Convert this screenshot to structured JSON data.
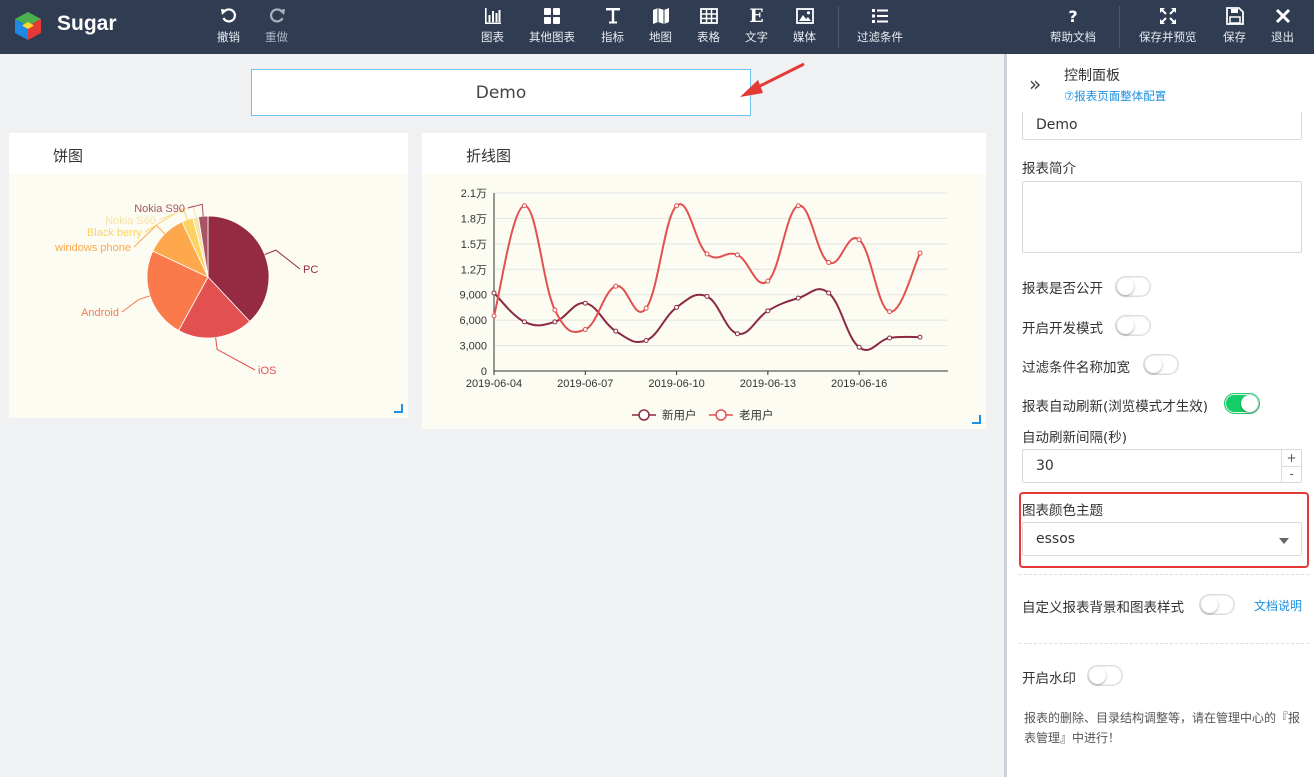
{
  "app": {
    "brand": "Sugar",
    "accent": "#2f3c52"
  },
  "toolbar": {
    "undo": "撤销",
    "redo": "重做",
    "chart": "图表",
    "other_charts": "其他图表",
    "metric": "指标",
    "map": "地图",
    "table": "表格",
    "text": "文字",
    "media": "媒体",
    "filter": "过滤条件",
    "help": "帮助文档",
    "save_preview": "保存并预览",
    "save": "保存",
    "exit": "退出"
  },
  "report": {
    "title": "Demo"
  },
  "pie_card": {
    "title": "饼图"
  },
  "line_card": {
    "title": "折线图"
  },
  "chart_data": [
    {
      "type": "pie",
      "title": "饼图",
      "slices": [
        {
          "label": "PC",
          "value": 38
        },
        {
          "label": "iOS",
          "value": 20
        },
        {
          "label": "Android",
          "value": 24
        },
        {
          "label": "windows phone",
          "value": 11
        },
        {
          "label": "Black berry",
          "value": 3
        },
        {
          "label": "Nokia S60",
          "value": 1.5
        },
        {
          "label": "Nokia S90",
          "value": 2.5
        }
      ],
      "colors": [
        "#952b43",
        "#e2504f",
        "#fb7a4b",
        "#fda84c",
        "#fdd35f",
        "#f7e3a8",
        "#a65466"
      ]
    },
    {
      "type": "line",
      "title": "折线图",
      "x": [
        "2019-06-04",
        "2019-06-05",
        "2019-06-06",
        "2019-06-07",
        "2019-06-08",
        "2019-06-09",
        "2019-06-10",
        "2019-06-11",
        "2019-06-12",
        "2019-06-13",
        "2019-06-14",
        "2019-06-15",
        "2019-06-16",
        "2019-06-17",
        "2019-06-18"
      ],
      "x_tick_labels": [
        "2019-06-04",
        "2019-06-07",
        "2019-06-10",
        "2019-06-13",
        "2019-06-16"
      ],
      "y_tick_labels": [
        "0",
        "3,000",
        "6,000",
        "9,000",
        "1.2万",
        "1.5万",
        "1.8万",
        "2.1万"
      ],
      "ylim": [
        0,
        21000
      ],
      "series": [
        {
          "name": "新用户",
          "color": "#8b2942",
          "values": [
            9200,
            5800,
            5800,
            8000,
            4700,
            3600,
            7500,
            8800,
            4400,
            7100,
            8600,
            9200,
            2800,
            3900,
            4000
          ]
        },
        {
          "name": "老用户",
          "color": "#e2504f",
          "values": [
            6500,
            19500,
            7200,
            4900,
            10000,
            7400,
            19500,
            13800,
            13700,
            10600,
            19500,
            12800,
            15500,
            7000,
            13900
          ]
        }
      ],
      "legend": "bottom"
    }
  ],
  "panel": {
    "title": "控制面板",
    "config_link": "⑦报表页面整体配置",
    "report_name_value": "Demo",
    "intro_label": "报表简介",
    "intro_value": "",
    "public_label": "报表是否公开",
    "dev_mode_label": "开启开发模式",
    "filter_width_label": "过滤条件名称加宽",
    "auto_refresh_label": "报表自动刷新(浏览模式才生效)",
    "interval_label": "自动刷新间隔(秒)",
    "interval_value": "30",
    "theme_label": "图表颜色主题",
    "theme_value": "essos",
    "custom_bg_label": "自定义报表背景和图表样式",
    "docs_link": "文档说明",
    "watermark_label": "开启水印",
    "note": "报表的删除、目录结构调整等，请在管理中心的『报表管理』中进行！",
    "switch_on_color": "#13ce66",
    "highlight_color": "#e53935"
  }
}
